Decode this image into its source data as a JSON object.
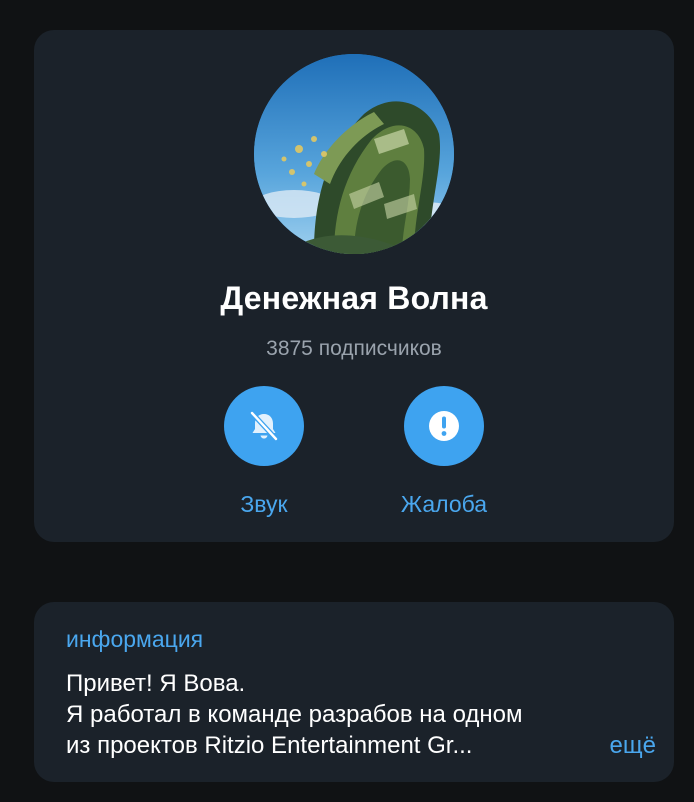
{
  "channel": {
    "name": "Денежная Волна",
    "subscribers": "3875 подписчиков"
  },
  "actions": {
    "sound_label": "Звук",
    "sound_icon": "bell-muted-icon",
    "report_label": "Жалоба",
    "report_icon": "exclamation-icon"
  },
  "info": {
    "heading": "информация",
    "line1": "Привет! Я Вова.",
    "line2": "Я работал в команде разрабов на одном",
    "line3": "из проектов Ritzio Entertainment Gr...",
    "more_label": "ещё"
  },
  "colors": {
    "background": "#101214",
    "card": "#1b222a",
    "accent": "#3ea3f0",
    "link": "#4aa7ee",
    "muted_text": "#9aa3ad"
  }
}
